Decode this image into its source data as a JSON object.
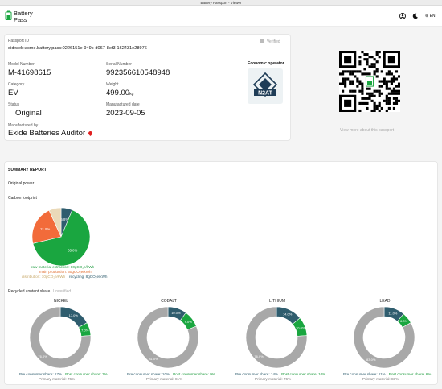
{
  "window": {
    "title": "Battery Passport - Viewer"
  },
  "header": {
    "logo_line1": "Battery",
    "logo_line2": "Pass",
    "user_icon": "user-icon",
    "theme_icon": "moon-icon",
    "language": "EN"
  },
  "passport": {
    "id_label": "Passport ID",
    "id_value": "did:web:acme.battery.pass:0226151e-949c-d067-8ef3-162431e28976",
    "verified_label": "Verified",
    "model_label": "Model Number",
    "model_value": "M-41698615",
    "serial_label": "Serial Number",
    "serial_value": "992356610548948",
    "category_label": "Category",
    "category_value": "EV",
    "weight_label": "Weight",
    "weight_value": "499.00",
    "weight_unit": "kg",
    "status_label": "Status",
    "status_value": "Original",
    "date_label": "Manufactured date",
    "date_value": "2023-09-05",
    "manufacturer_label": "Manufactured by",
    "manufacturer_value": "Exide Batteries Auditor",
    "economic_operator_label": "Economic operator",
    "operator_logo_text": "N2AT"
  },
  "qr": {
    "link_text": "View more about this passport"
  },
  "summary": {
    "title": "SUMMARY REPORT",
    "original_power": "Original power",
    "carbon_label": "Carbon footprint",
    "legend_raw": "raw material extraction: 80gCO₂e/kWh",
    "legend_main": "main production: 30gCO₂e/kWh",
    "legend_dist": "distribution: 10gCO₂e/kWh",
    "legend_recycling": "recycling: 8gCO₂e/kWh",
    "recycled_label": "Recycled content share",
    "unverified": "Unverified"
  },
  "chart_data": [
    {
      "type": "pie",
      "title": "Carbon footprint",
      "categories": [
        "raw material extraction",
        "main production",
        "distribution",
        "recycling"
      ],
      "values": [
        65.0,
        21.9,
        6.8,
        6.3
      ],
      "value_labels": [
        "65.0%",
        "21.9%",
        "",
        "5.8%"
      ],
      "colors": [
        "#1aa640",
        "#f26b3a",
        "#ead9b8",
        "#2f5d6e"
      ]
    },
    {
      "type": "pie",
      "title": "NICKEL",
      "categories": [
        "Pre consumer share",
        "Post consumer share",
        "Primary material"
      ],
      "values": [
        17,
        7,
        76
      ],
      "value_labels": [
        "17.0%",
        "7.0%",
        "76.0%"
      ],
      "colors": [
        "#2f5d6e",
        "#1aa640",
        "#a8a8a8"
      ],
      "pre_text": "Pre consumer share: 17%",
      "post_text": "Post consumer share: 7%",
      "primary_text": "Primary material: 76%"
    },
    {
      "type": "pie",
      "title": "COBALT",
      "categories": [
        "Pre consumer share",
        "Post consumer share",
        "Primary material"
      ],
      "values": [
        10,
        9,
        81
      ],
      "value_labels": [
        "10.0%",
        "9.0%",
        "81.0%"
      ],
      "colors": [
        "#2f5d6e",
        "#1aa640",
        "#a8a8a8"
      ],
      "pre_text": "Pre consumer share: 10%",
      "post_text": "Post consumer share: 9%",
      "primary_text": "Primary material: 81%"
    },
    {
      "type": "pie",
      "title": "LITHIUM",
      "categories": [
        "Pre consumer share",
        "Post consumer share",
        "Primary material"
      ],
      "values": [
        14,
        10,
        76
      ],
      "value_labels": [
        "14.0%",
        "10.0%",
        "76.0%"
      ],
      "colors": [
        "#2f5d6e",
        "#1aa640",
        "#a8a8a8"
      ],
      "pre_text": "Pre consumer share: 14%",
      "post_text": "Post consumer share: 10%",
      "primary_text": "Primary material: 76%"
    },
    {
      "type": "pie",
      "title": "LEAD",
      "categories": [
        "Pre consumer share",
        "Post consumer share",
        "Primary material"
      ],
      "values": [
        11,
        6,
        83
      ],
      "value_labels": [
        "11.0%",
        "6.0%",
        "83.0%"
      ],
      "colors": [
        "#2f5d6e",
        "#1aa640",
        "#a8a8a8"
      ],
      "pre_text": "Pre consumer share: 11%",
      "post_text": "Post consumer share: 6%",
      "primary_text": "Primary material: 83%"
    }
  ]
}
